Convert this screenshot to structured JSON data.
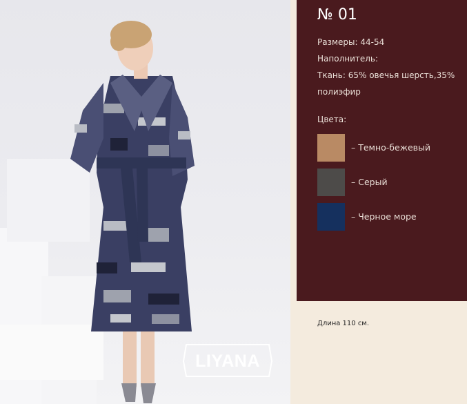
{
  "product": {
    "number": "№ 01",
    "sizes": "Размеры: 44-54",
    "filler": "Наполнитель:",
    "fabric_line1": "Ткань: 65% овечья шерсть,35%",
    "fabric_line2": "полиэфир",
    "colors_heading": "Цвета:",
    "colors": [
      {
        "label": "– Темно-бежевый",
        "hex": "#b98a64"
      },
      {
        "label": "– Серый",
        "hex": "#4d4b49"
      },
      {
        "label": "– Черное море",
        "hex": "#15305e"
      }
    ],
    "length": "Длина 110 см."
  },
  "brand": {
    "logo_text": "LIYANA"
  },
  "theme": {
    "panel_color": "#4a1a1e",
    "page_color": "#f4ebde"
  }
}
